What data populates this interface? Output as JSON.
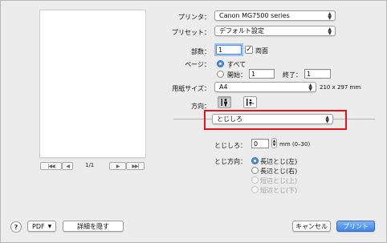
{
  "preview": {
    "page_count": "1/1",
    "first_label": "|◀◀",
    "prev_label": "◀",
    "next_label": "▶",
    "last_label": "▶▶|"
  },
  "printer": {
    "label": "プリンタ：",
    "value": "Canon MG7500 series"
  },
  "preset": {
    "label": "プリセット：",
    "value": "デフォルト設定"
  },
  "copies": {
    "label": "部数：",
    "value": "1",
    "duplex_label": "両面",
    "duplex_checked": true
  },
  "pages": {
    "label": "ページ：",
    "all_label": "すべて",
    "from_label": "開始：",
    "from_value": "1",
    "to_label": "終了：",
    "to_value": "1"
  },
  "paper_size": {
    "label": "用紙サイズ：",
    "value": "A4",
    "dimensions": "210 x 297 mm"
  },
  "orientation": {
    "label": "方向："
  },
  "panel_menu": {
    "value": "とじしろ"
  },
  "margin": {
    "label": "とじしろ：",
    "value": "0",
    "unit_range": "mm (0–30)"
  },
  "binding": {
    "label": "とじ方向：",
    "options": [
      "長辺とじ(左)",
      "長辺とじ(右)",
      "短辺とじ(上)",
      "短辺とじ(下)"
    ]
  },
  "footer": {
    "help_label": "?",
    "pdf_label": "PDF",
    "hide_details_label": "詳細を隠す",
    "cancel_label": "キャンセル",
    "print_label": "プリント"
  },
  "colors": {
    "accent": "#4d8ce6",
    "highlight_border": "#e0141c"
  }
}
